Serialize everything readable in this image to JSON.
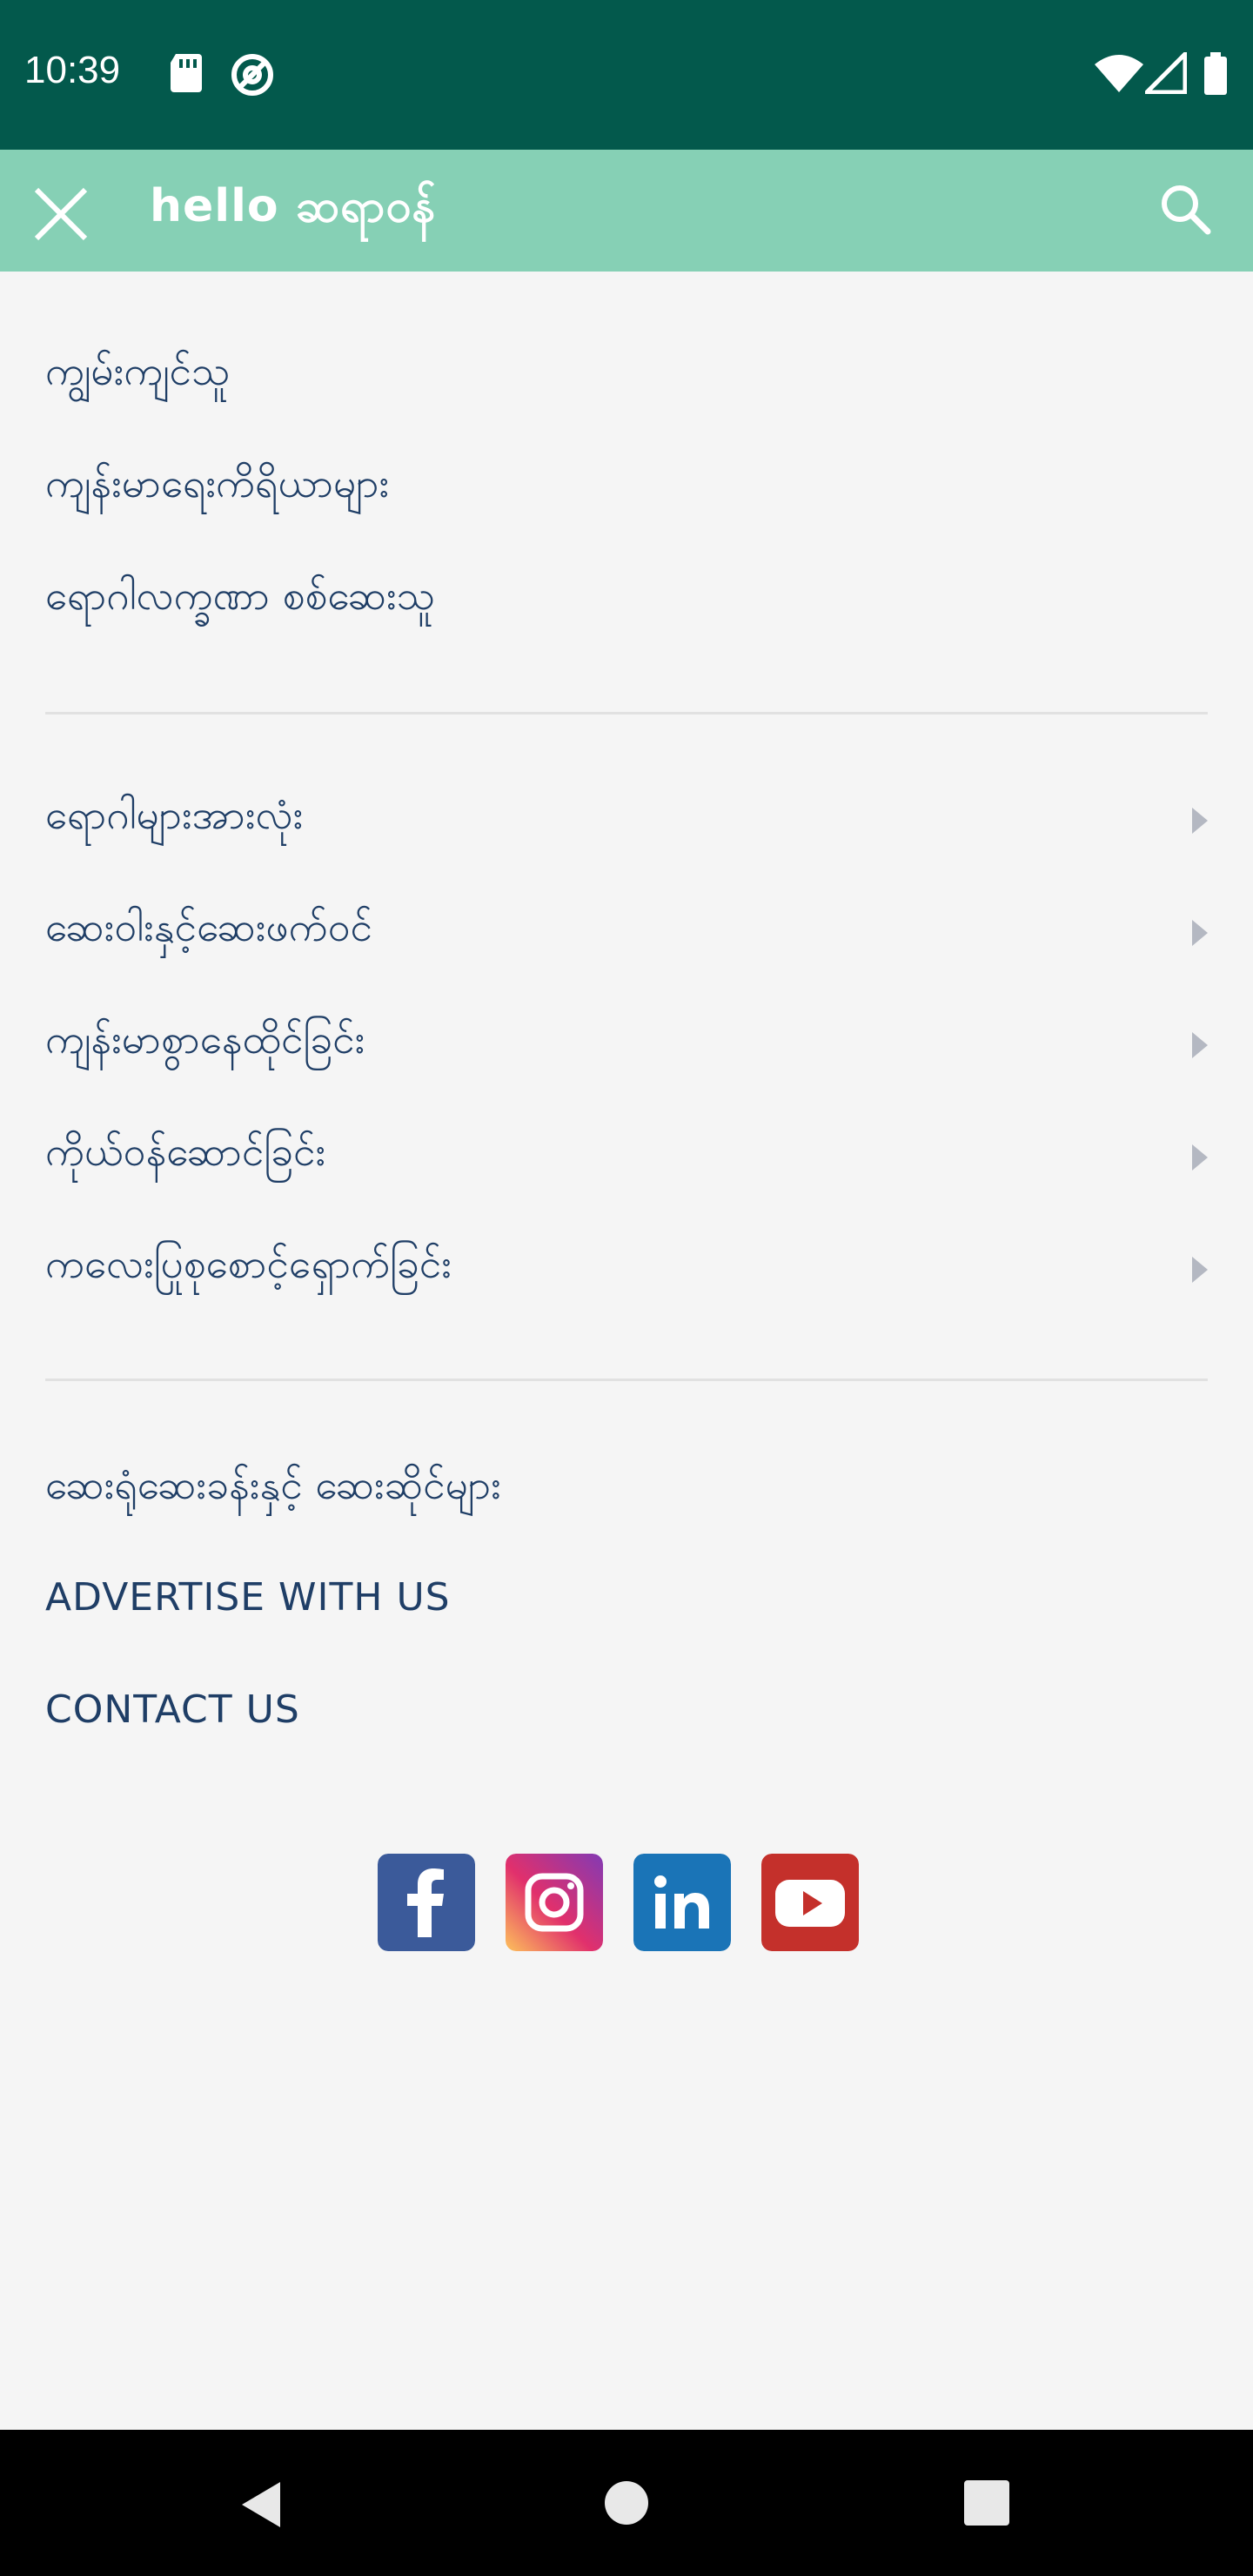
{
  "status_bar": {
    "time": "10:39",
    "icons": [
      "sd-card-icon",
      "at-sign-icon",
      "wifi-icon",
      "signal-icon",
      "battery-icon"
    ],
    "background": "#03594c"
  },
  "toolbar": {
    "brand": "hello ဆရာဝန်",
    "background": "#86d0b5",
    "close_icon": "close-icon",
    "search_icon": "search-icon"
  },
  "menu": {
    "group1": [
      "ကျွမ်းကျင်သူ",
      "ကျန်းမာရေးကိရိယာများ",
      "ရောဂါလက္ခဏာ စစ်ဆေးသူ"
    ],
    "group2": [
      "ရောဂါများအားလုံး",
      "ဆေးဝါးနှင့်ဆေးဖက်ဝင်",
      "ကျန်းမာစွာနေထိုင်ခြင်း",
      "ကိုယ်ဝန်ဆောင်ခြင်း",
      "ကလေးပြုစုစောင့်ရှောက်ခြင်း"
    ],
    "group3": [
      "ဆေးရုံဆေးခန်းနှင့် ဆေးဆိုင်များ",
      "ADVERTISE WITH US",
      "CONTACT US"
    ]
  },
  "social": [
    {
      "name": "facebook-icon",
      "color": "#3b5a9a"
    },
    {
      "name": "instagram-icon",
      "color": "#c13584"
    },
    {
      "name": "linkedin-icon",
      "color": "#1a74b7"
    },
    {
      "name": "youtube-icon",
      "color": "#c4302b"
    }
  ],
  "nav_bar": {
    "icons": [
      "back-icon",
      "home-icon",
      "recents-icon"
    ]
  }
}
